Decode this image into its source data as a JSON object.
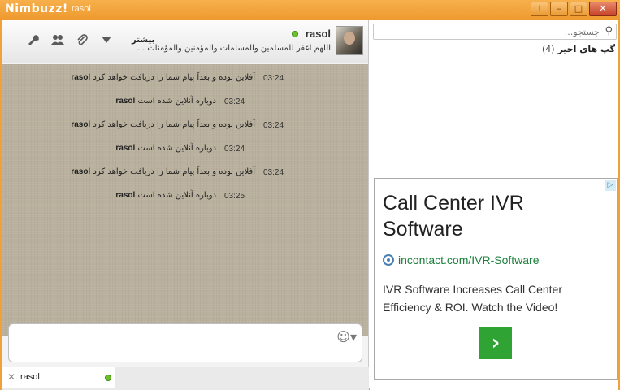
{
  "window": {
    "app_name": "Nimbuzz!",
    "user": "rasol",
    "buttons": [
      "pin",
      "minimize",
      "maximize",
      "close"
    ]
  },
  "chat": {
    "contact_name": "rasol",
    "contact_status": "اللهم اغفر للمسلمين والمسلمات والمؤمنين والمؤمنات ...",
    "toolbar": {
      "more_label": "بیشتر",
      "icons": [
        "chevron-down-icon",
        "paperclip-icon",
        "contacts-icon",
        "wrench-icon"
      ]
    },
    "messages": [
      {
        "time": "03:24",
        "text": "آفلاین بوده و بعداً پیام شما را دریافت خواهد کرد",
        "user": "rasol"
      },
      {
        "time": "03:24",
        "text": "دوباره آنلاین شده است",
        "user": "rasol"
      },
      {
        "time": "03:24",
        "text": "آفلاین بوده و بعداً پیام شما را دریافت خواهد کرد",
        "user": "rasol"
      },
      {
        "time": "03:24",
        "text": "دوباره آنلاین شده است",
        "user": "rasol"
      },
      {
        "time": "03:24",
        "text": "آفلاین بوده و بعداً پیام شما را دریافت خواهد کرد",
        "user": "rasol"
      },
      {
        "time": "03:25",
        "text": "دوباره آنلاین شده است",
        "user": "rasol"
      }
    ],
    "tab": {
      "label": "rasol"
    }
  },
  "right": {
    "search_placeholder": "جستجو...",
    "recent_label": "گپ های اخیر",
    "recent_count": "(4)"
  },
  "ad": {
    "title": "Call Center IVR Software",
    "url": "incontact.com/IVR-Software",
    "description": "IVR Software Increases Call Center Efficiency & ROI. Watch the Video!",
    "go_symbol": "›",
    "adchoices": "▷"
  },
  "colors": {
    "titlebar": "#ee9a2f",
    "chat_background": "#b9b09d",
    "online": "#6fbf2b",
    "ad_url": "#1a7f3a",
    "ad_button": "#2fa333"
  }
}
